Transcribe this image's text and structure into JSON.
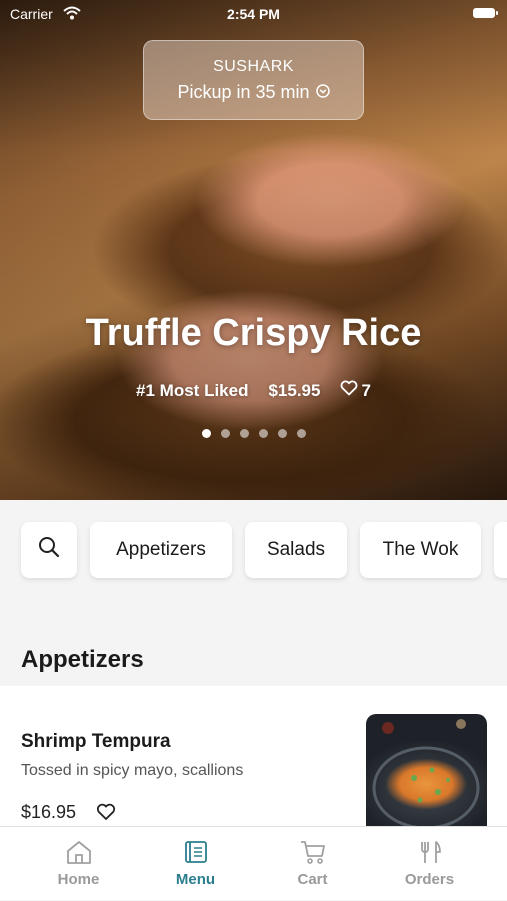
{
  "status_bar": {
    "carrier": "Carrier",
    "time": "2:54 PM"
  },
  "pickup": {
    "brand": "SUSHARK",
    "eta": "Pickup in 35 min"
  },
  "hero": {
    "title": "Truffle Crispy Rice",
    "tag": "#1 Most Liked",
    "price": "$15.95",
    "likes": "7",
    "carousel": {
      "page_count": 6,
      "active_index": 0
    }
  },
  "categories": [
    "Appetizers",
    "Salads",
    "The Wok"
  ],
  "section": {
    "title": "Appetizers"
  },
  "items": [
    {
      "name": "Shrimp Tempura",
      "description": "Tossed in spicy mayo, scallions",
      "price": "$16.95"
    }
  ],
  "tabs": [
    {
      "label": "Home",
      "icon": "home-icon",
      "active": false
    },
    {
      "label": "Menu",
      "icon": "menu-book-icon",
      "active": true
    },
    {
      "label": "Cart",
      "icon": "cart-icon",
      "active": false
    },
    {
      "label": "Orders",
      "icon": "utensils-icon",
      "active": false
    }
  ],
  "colors": {
    "accent": "#2b7e8e",
    "tab_inactive": "#9a9a9a"
  }
}
